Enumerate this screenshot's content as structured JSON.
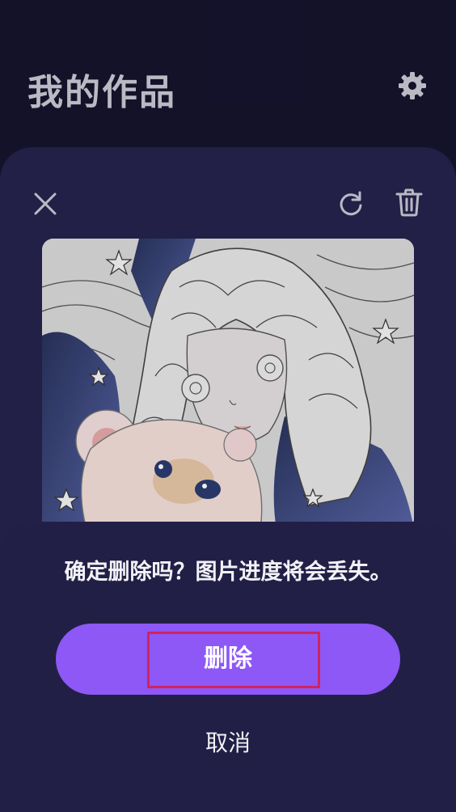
{
  "header": {
    "title": "我的作品",
    "settings_icon": "gear-icon"
  },
  "editor": {
    "close_icon": "close-icon",
    "refresh_icon": "refresh-icon",
    "trash_icon": "trash-icon",
    "artwork": "anime girl with teddy bear coloring artwork"
  },
  "dialog": {
    "message": "确定删除吗？图片进度将会丢失。",
    "delete_label": "删除",
    "cancel_label": "取消"
  },
  "colors": {
    "background": "#15132b",
    "card": "#24224a",
    "sheet": "#221f46",
    "accent": "#8d58f6",
    "highlight": "#d0245e"
  }
}
